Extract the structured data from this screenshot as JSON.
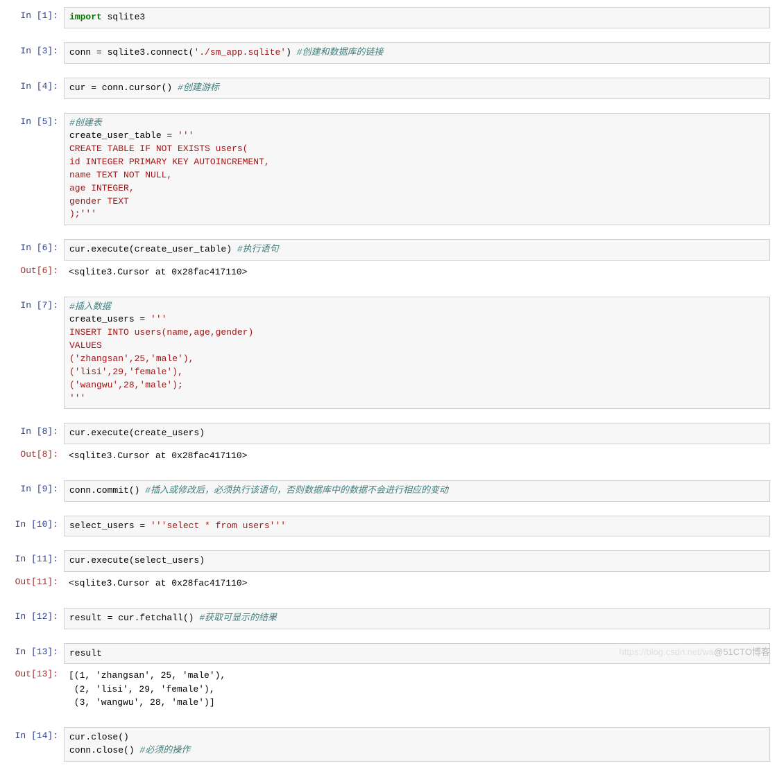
{
  "prompts": {
    "in1": "In  [1]:",
    "in3": "In  [3]:",
    "in4": "In  [4]:",
    "in5": "In  [5]:",
    "in6": "In  [6]:",
    "out6": "Out[6]:",
    "in7": "In  [7]:",
    "in8": "In  [8]:",
    "out8": "Out[8]:",
    "in9": "In  [9]:",
    "in10": "In [10]:",
    "in11": "In [11]:",
    "out11": "Out[11]:",
    "in12": "In [12]:",
    "in13": "In [13]:",
    "out13": "Out[13]:",
    "in14": "In [14]:"
  },
  "c1": {
    "kw": "import",
    "mod": " sqlite3"
  },
  "c3": {
    "pre": "conn = sqlite3.connect(",
    "str": "'./sm_app.sqlite'",
    "post": ") ",
    "comment": "#创建和数据库的链接"
  },
  "c4": {
    "pre": "cur = conn.cursor() ",
    "comment": "#创建游标"
  },
  "c5": {
    "comment": "#创建表",
    "line1": "create_user_table = ",
    "s1": "'''",
    "s2": "CREATE TABLE IF NOT EXISTS users(",
    "s3": "id INTEGER PRIMARY KEY AUTOINCREMENT,",
    "s4": "name TEXT NOT NULL,",
    "s5": "age INTEGER,",
    "s6": "gender TEXT",
    "s7": ");'''"
  },
  "c6": {
    "pre": "cur.execute(create_user_table) ",
    "comment": "#执行语句"
  },
  "o6": "<sqlite3.Cursor at 0x28fac417110>",
  "c7": {
    "comment": "#插入数据",
    "line1": "create_users = ",
    "s1": "'''",
    "s2": "INSERT INTO users(name,age,gender)",
    "s3": "VALUES",
    "s4": "('zhangsan',25,'male'),",
    "s5": "('lisi',29,'female'),",
    "s6": "('wangwu',28,'male');",
    "s7": "'''"
  },
  "c8": {
    "text": "cur.execute(create_users)"
  },
  "o8": "<sqlite3.Cursor at 0x28fac417110>",
  "c9": {
    "pre": "conn.commit() ",
    "comment": "#插入或修改后，必须执行该语句，否则数据库中的数据不会进行相应的变动"
  },
  "c10": {
    "pre": "select_users = ",
    "str": "'''select * from users'''"
  },
  "c11": {
    "text": "cur.execute(select_users)"
  },
  "o11": "<sqlite3.Cursor at 0x28fac417110>",
  "c12": {
    "pre": "result = cur.fetchall() ",
    "comment": "#获取可显示的结果"
  },
  "c13": {
    "text": "result"
  },
  "o13": "[(1, 'zhangsan', 25, 'male'),\n (2, 'lisi', 29, 'female'),\n (3, 'wangwu', 28, 'male')]",
  "c14": {
    "line1": "cur.close()",
    "pre2": "conn.close() ",
    "comment": "#必须的操作"
  },
  "watermark": {
    "faint": "https://blog.csdn.net/wa",
    "main": "@51CTO博客"
  }
}
